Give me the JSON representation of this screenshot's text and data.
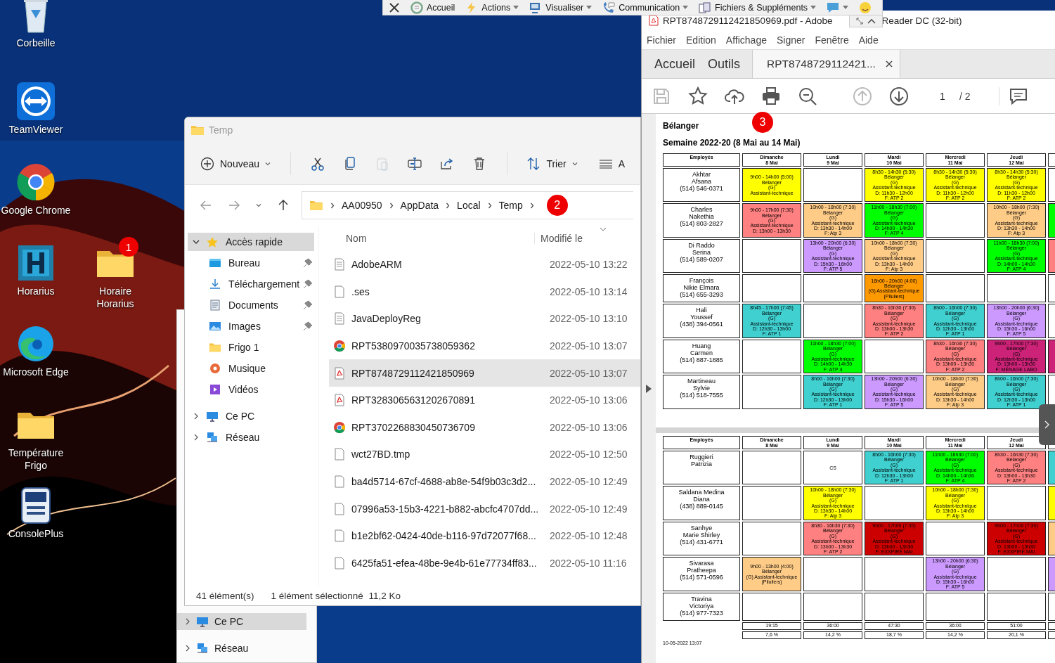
{
  "desktop": {
    "icons": [
      {
        "label": "Corbeille",
        "kind": "recycle"
      },
      {
        "label": "TeamViewer",
        "kind": "teamviewer"
      },
      {
        "label": "Google Chrome",
        "kind": "chrome"
      },
      {
        "label": "Horarius",
        "kind": "horarius"
      },
      {
        "label": "Horaire Horarius",
        "kind": "folder",
        "badge": "1"
      },
      {
        "label": "Microsoft Edge",
        "kind": "edge"
      },
      {
        "label": "Température Frigo",
        "kind": "folder"
      },
      {
        "label": "ConsolePlus",
        "kind": "console"
      }
    ]
  },
  "remote_toolbar": {
    "items": [
      {
        "label": "Accueil",
        "kind": "home",
        "dropdown": false
      },
      {
        "label": "Actions",
        "kind": "bolt",
        "dropdown": true
      },
      {
        "label": "Visualiser",
        "kind": "monitor",
        "dropdown": true
      },
      {
        "label": "Communication",
        "kind": "phone",
        "dropdown": true
      },
      {
        "label": "Fichiers & Suppléments",
        "kind": "files",
        "dropdown": true
      },
      {
        "kind": "chat",
        "dropdown": true
      },
      {
        "kind": "smiley",
        "dropdown": false
      }
    ]
  },
  "explorer": {
    "title": "Temp",
    "toolbar": {
      "new": "Nouveau",
      "sort": "Trier",
      "view": "A",
      "actions": [
        {
          "kind": "cut",
          "disabled": false
        },
        {
          "kind": "copy",
          "disabled": false
        },
        {
          "kind": "paste",
          "disabled": true
        },
        {
          "kind": "rename",
          "disabled": false
        },
        {
          "kind": "share",
          "disabled": false
        },
        {
          "kind": "delete",
          "disabled": false
        }
      ]
    },
    "breadcrumb": [
      "AA00950",
      "AppData",
      "Local",
      "Temp"
    ],
    "badge": "2",
    "nav": [
      {
        "label": "Accès rapide",
        "kind": "star",
        "expanded": true,
        "selected": true,
        "children": [
          {
            "label": "Bureau",
            "kind": "desktop",
            "pinned": true,
            "selected": false
          },
          {
            "label": "Téléchargement",
            "kind": "download",
            "pinned": true,
            "selected": false
          },
          {
            "label": "Documents",
            "kind": "documents",
            "pinned": true,
            "selected": false
          },
          {
            "label": "Images",
            "kind": "images",
            "pinned": true,
            "selected": false
          },
          {
            "label": "Frigo 1",
            "kind": "folder",
            "pinned": false,
            "selected": false
          },
          {
            "label": "Musique",
            "kind": "music",
            "pinned": false,
            "selected": false
          },
          {
            "label": "Vidéos",
            "kind": "videos",
            "pinned": false,
            "selected": false
          }
        ]
      },
      {
        "label": "Ce PC",
        "kind": "pc",
        "expanded": false,
        "selected": false
      },
      {
        "label": "Réseau",
        "kind": "network",
        "expanded": false,
        "selected": false
      }
    ],
    "columns": [
      "Nom",
      "Modifié le"
    ],
    "files": [
      {
        "name": "AdobeARM",
        "modified": "2022-05-10 13:22",
        "kind": "text",
        "selected": false
      },
      {
        "name": ".ses",
        "modified": "2022-05-10 13:14",
        "kind": "blank",
        "selected": false
      },
      {
        "name": "JavaDeployReg",
        "modified": "2022-05-10 13:10",
        "kind": "text",
        "selected": false
      },
      {
        "name": "RPT5380970035738059362",
        "modified": "2022-05-10 13:07",
        "kind": "chrome",
        "selected": false
      },
      {
        "name": "RPT8748729112421850969",
        "modified": "2022-05-10 13:07",
        "kind": "pdf",
        "selected": true
      },
      {
        "name": "RPT3283065631202670891",
        "modified": "2022-05-10 13:06",
        "kind": "pdf",
        "selected": false
      },
      {
        "name": "RPT3702268830450736709",
        "modified": "2022-05-10 13:06",
        "kind": "chrome",
        "selected": false
      },
      {
        "name": "wct27BD.tmp",
        "modified": "2022-05-10 12:50",
        "kind": "blank",
        "selected": false
      },
      {
        "name": "ba4d5714-67cf-4688-ab8e-54f9b03c3d2...",
        "modified": "2022-05-10 12:49",
        "kind": "blank",
        "selected": false
      },
      {
        "name": "07996a53-15b3-4221-b882-abcfc4707dd...",
        "modified": "2022-05-10 12:49",
        "kind": "blank",
        "selected": false
      },
      {
        "name": "b1e2bf62-0424-40de-b116-97d72077f68...",
        "modified": "2022-05-10 12:48",
        "kind": "blank",
        "selected": false
      },
      {
        "name": "6425fa51-efea-48be-9e4b-61e77734ff83...",
        "modified": "2022-05-10 11:16",
        "kind": "blank",
        "selected": false
      }
    ],
    "status": {
      "count": "41 élément(s)",
      "selection": "1 élément sélectionné",
      "size": "11,2 Ko"
    }
  },
  "background_window": {
    "nav": [
      {
        "label": "Ce PC",
        "kind": "pc",
        "selected": true
      },
      {
        "label": "Réseau",
        "kind": "network",
        "selected": false
      }
    ]
  },
  "reader": {
    "title": [
      "RPT8748729112421850969.pdf - Adobe",
      "Reader DC (32-bit)"
    ],
    "menu": [
      "Fichier",
      "Edition",
      "Affichage",
      "Signer",
      "Fenêtre",
      "Aide"
    ],
    "tabs": [
      {
        "label": "Accueil",
        "selected": false,
        "closable": false
      },
      {
        "label": "Outils",
        "selected": false,
        "closable": false
      },
      {
        "label": "RPT87487291124​21...",
        "selected": true,
        "closable": true
      }
    ],
    "toolbar": {
      "actions": [
        {
          "kind": "save",
          "disabled": true
        },
        {
          "kind": "star",
          "disabled": false
        },
        {
          "kind": "upload",
          "disabled": false
        },
        {
          "kind": "print",
          "disabled": false
        },
        {
          "kind": "zoom",
          "disabled": false
        },
        {
          "kind": "up",
          "disabled": true
        },
        {
          "kind": "down",
          "disabled": false
        }
      ],
      "page": "1",
      "pages": "/ 2",
      "badge": "3"
    },
    "document": {
      "heading": "Bélanger",
      "subtitle": "Semaine 2022-20 (8 Mai au 14 Mai)",
      "pages": [
        {
          "employee_header": "Employés",
          "columns": [
            {
              "day": "Dimanche",
              "date": "8 Mai"
            },
            {
              "day": "Lundi",
              "date": "9 Mai"
            },
            {
              "day": "Mardi",
              "date": "10 Mai"
            },
            {
              "day": "Mercredi",
              "date": "11 Mai"
            },
            {
              "day": "Jeudi",
              "date": "12 Mai"
            }
          ],
          "rows": [
            {
              "name": [
                "Akhtar",
                "Afsana",
                "(514) 546-0371"
              ],
              "cells": [
                {
                  "color": "#ffff00",
                  "lines": [
                    "9h00 - 14h00 (5:00)",
                    "Bélanger",
                    "(G)",
                    "Assistant-technique"
                  ]
                },
                {
                  "color": "#ffffff"
                },
                {
                  "color": "#ffff00",
                  "lines": [
                    "8h30 - 14h30 (5:30)",
                    "Bélanger",
                    "(G)",
                    "Assistant-technique",
                    "D: 11h30 - 12h00",
                    "F: ATP 2"
                  ]
                },
                {
                  "color": "#ffff00",
                  "lines": [
                    "8h30 - 14h30 (5:30)",
                    "Bélanger",
                    "(G)",
                    "Assistant-technique",
                    "D: 11h30 - 12h00",
                    "F: ATP 2"
                  ]
                },
                {
                  "color": "#ffff00",
                  "lines": [
                    "8h30 - 14h30 (5:30)",
                    "Bélanger",
                    "(G)",
                    "Assistant-technique",
                    "D: 11h30 - 12h00",
                    "F: ATP 2"
                  ]
                },
                {
                  "color": "#ffffff"
                }
              ]
            },
            {
              "name": [
                "Charles",
                "Nakethia",
                "(514) 803-2827"
              ],
              "cells": [
                {
                  "color": "#ff8080",
                  "lines": [
                    "9h00 - 17h00 (7:30)",
                    "Bélanger",
                    "(G)",
                    "Assistant-technique",
                    "D: 13h00 - 13h30"
                  ]
                },
                {
                  "color": "#ffcc88",
                  "lines": [
                    "10h00 - 18h00 (7:30)",
                    "Bélanger",
                    "(G)",
                    "Assistant-technique",
                    "D: 13h30 - 14h00",
                    "F: Atp 3"
                  ]
                },
                {
                  "color": "#00ff00",
                  "lines": [
                    "11h00 - 18h30 (7:00)",
                    "Bélanger",
                    "(G)",
                    "Assistant-technique",
                    "D: 14h00 - 14h30",
                    "F: ATP 4"
                  ]
                },
                {
                  "color": "#ffffff"
                },
                {
                  "color": "#ffcc88",
                  "lines": [
                    "10h00 - 18h00 (7:30)",
                    "Bélanger",
                    "(G)",
                    "Assistant-technique",
                    "D: 13h30 - 14h00",
                    "F: Atp 3"
                  ]
                },
                {
                  "color": "#00ff00"
                }
              ]
            },
            {
              "name": [
                "Di Raddo",
                "Serina",
                "(514) 589-0207"
              ],
              "cells": [
                {
                  "color": "#ffffff"
                },
                {
                  "color": "#cc99ff",
                  "lines": [
                    "13h00 - 20h00 (6:30)",
                    "Bélanger",
                    "(G)",
                    "Assistant-technique",
                    "D: 15h30 - 16h00",
                    "F: ATP 5"
                  ]
                },
                {
                  "color": "#ffcc88",
                  "lines": [
                    "10h00 - 18h00 (7:30)",
                    "Bélanger",
                    "(G)",
                    "Assistant-technique",
                    "D: 13h30 - 14h00",
                    "F: Atp 3"
                  ]
                },
                {
                  "color": "#ffffff"
                },
                {
                  "color": "#00ff00",
                  "lines": [
                    "11h00 - 18h30 (7:00)",
                    "Bélanger",
                    "(G)",
                    "Assistant-technique",
                    "D: 14h00 - 14h30",
                    "F: ATP 4"
                  ]
                },
                {
                  "color": "#ff8080"
                }
              ]
            },
            {
              "name": [
                "François",
                "Nikie Elmara",
                "(514) 655-3293"
              ],
              "cells": [
                {
                  "color": "#ffffff"
                },
                {
                  "color": "#ffffff"
                },
                {
                  "color": "#ff9900",
                  "lines": [
                    "16h00 - 20h00 (4:00)",
                    "Bélanger",
                    "(G) Assistant-technique",
                    "(Piluliers)"
                  ]
                },
                {
                  "color": "#ffffff"
                },
                {
                  "color": "#ffffff"
                },
                {
                  "color": "#ffffff"
                }
              ]
            },
            {
              "name": [
                "Hali",
                "Youssef",
                "(438) 394-0561"
              ],
              "cells": [
                {
                  "color": "#40d0d0",
                  "lines": [
                    "8h45 - 17h00 (7:45)",
                    "Bélanger",
                    "(G)",
                    "Assistant-technique",
                    "D: 12h30 - 13h00",
                    "F: ATP 1"
                  ]
                },
                {
                  "color": "#ffffff"
                },
                {
                  "color": "#ff8080",
                  "lines": [
                    "8h30 - 16h30 (7:30)",
                    "Bélanger",
                    "(G)",
                    "Assistant-technique",
                    "D: 13h00 - 13h30",
                    "F: ATP 2"
                  ]
                },
                {
                  "color": "#40d0d0",
                  "lines": [
                    "8h00 - 16h00 (7:30)",
                    "Bélanger",
                    "(G)",
                    "Assistant-technique",
                    "D: 12h30 - 13h00",
                    "F: ATP 1"
                  ]
                },
                {
                  "color": "#cc99ff",
                  "lines": [
                    "13h00 - 20h00 (6:30)",
                    "Bélanger",
                    "(G)",
                    "Assistant-technique",
                    "D: 15h30 - 16h00",
                    "F: ATP 5"
                  ]
                },
                {
                  "color": "#ffffff"
                }
              ]
            },
            {
              "name": [
                "Huang",
                "Carmen",
                "(514) 887-1885"
              ],
              "cells": [
                {
                  "color": "#ffffff"
                },
                {
                  "color": "#00ff00",
                  "lines": [
                    "11h00 - 18h30 (7:00)",
                    "Bélanger",
                    "(G)",
                    "Assistant-technique",
                    "D: 14h00 - 14h30",
                    "F: ATP 4"
                  ]
                },
                {
                  "color": "#ffffff"
                },
                {
                  "color": "#ff8080",
                  "lines": [
                    "8h30 - 16h30 (7:30)",
                    "Bélanger",
                    "(G)",
                    "Assistant-technique",
                    "D: 13h00 - 13h30",
                    "F: ATP 2"
                  ]
                },
                {
                  "color": "#cc2277",
                  "lines": [
                    "9h00 - 17h00 (7:30)",
                    "Bélanger",
                    "(G)",
                    "Assistant-technique",
                    "D: 13h00 - 13h30",
                    "F: MÉNAGE LABO"
                  ]
                },
                {
                  "color": "#cc2277"
                }
              ]
            },
            {
              "name": [
                "Martineau",
                "Sylvie",
                "(514) 518-7555"
              ],
              "cells": [
                {
                  "color": "#ffffff"
                },
                {
                  "color": "#40d0d0",
                  "lines": [
                    "8h00 - 16h00 (7:30)",
                    "Bélanger",
                    "(G)",
                    "Assistant-technique",
                    "D: 12h30 - 13h00",
                    "F: ATP 1"
                  ]
                },
                {
                  "color": "#cc99ff",
                  "lines": [
                    "13h00 - 20h00 (6:30)",
                    "Bélanger",
                    "(G)",
                    "Assistant-technique",
                    "D: 15h30 - 16h00",
                    "F: ATP 5"
                  ]
                },
                {
                  "color": "#ffcc88",
                  "lines": [
                    "10h00 - 18h00 (7:30)",
                    "Bélanger",
                    "(G)",
                    "Assistant-technique",
                    "D: 13h30 - 14h00",
                    "F: Atp 3"
                  ]
                },
                {
                  "color": "#40d0d0",
                  "lines": [
                    "8h00 - 16h00 (7:30)",
                    "Bélanger",
                    "(G)",
                    "Assistant-technique",
                    "D: 12h30 - 13h00",
                    "F: ATP 1"
                  ]
                },
                {
                  "color": "#ffffff"
                }
              ]
            }
          ]
        },
        {
          "employee_header": "Employés",
          "columns": [
            {
              "day": "Dimanche",
              "date": "8 Mai"
            },
            {
              "day": "Lundi",
              "date": "9 Mai"
            },
            {
              "day": "Mardi",
              "date": "10 Mai"
            },
            {
              "day": "Mercredi",
              "date": "11 Mai"
            },
            {
              "day": "Jeudi",
              "date": "12 Mai"
            }
          ],
          "rows": [
            {
              "name": [
                "Ruggieri",
                "Patrizia"
              ],
              "cells": [
                {
                  "color": "#ffffff"
                },
                {
                  "color": "#ffffff",
                  "lines": [
                    "CS"
                  ]
                },
                {
                  "color": "#40d0d0",
                  "lines": [
                    "8h00 - 16h00 (7:30)",
                    "Bélanger",
                    "(G)",
                    "Assistant-technique",
                    "D: 12h30 - 13h00",
                    "F: ATP 1"
                  ]
                },
                {
                  "color": "#00ff00",
                  "lines": [
                    "11h00 - 18h30 (7:00)",
                    "Bélanger",
                    "(G)",
                    "Assistant-technique",
                    "D: 14h00 - 14h30",
                    "F: ATP 4"
                  ]
                },
                {
                  "color": "#ff8080",
                  "lines": [
                    "8h30 - 16h30 (7:30)",
                    "Bélanger",
                    "(G)",
                    "Assistant-technique",
                    "D: 13h00 - 13h30",
                    "F: ATP 2"
                  ]
                },
                {
                  "color": "#40d0d0"
                }
              ]
            },
            {
              "name": [
                "Saldana Medina",
                "Diana",
                "(438) 889-0145"
              ],
              "cells": [
                {
                  "color": "#ffffff"
                },
                {
                  "color": "#ffff00",
                  "lines": [
                    "10h00 - 18h00 (7:30)",
                    "Bélanger",
                    "(G)",
                    "Assistant-technique",
                    "D: 13h30 - 14h00",
                    "F: Atp 3"
                  ]
                },
                {
                  "color": "#ffffff"
                },
                {
                  "color": "#ffff00",
                  "lines": [
                    "10h00 - 18h00 (7:30)",
                    "Bélanger",
                    "(G)",
                    "Assistant-technique",
                    "D: 13h30 - 14h00",
                    "F: Atp 3"
                  ]
                },
                {
                  "color": "#ffffff"
                },
                {
                  "color": "#ffff00"
                }
              ]
            },
            {
              "name": [
                "Sanhye",
                "Marie Shirley",
                "(514) 431-6771"
              ],
              "cells": [
                {
                  "color": "#ffffff"
                },
                {
                  "color": "#ff8080",
                  "lines": [
                    "8h30 - 16h30 (7:30)",
                    "Bélanger",
                    "(G)",
                    "Assistant-technique",
                    "D: 13h00 - 13h30",
                    "F: ATP 2"
                  ]
                },
                {
                  "color": "#cc0000",
                  "lines": [
                    "9h00 - 17h00 (7:30)",
                    "Bélanger",
                    "(G)",
                    "Assistant-technique",
                    "D: 13h00 - 13h30",
                    "F: EXXPIRÉ MAI"
                  ]
                },
                {
                  "color": "#ffffff"
                },
                {
                  "color": "#cc0000",
                  "lines": [
                    "9h00 - 17h00 (7:30)",
                    "Bélanger",
                    "(G)",
                    "Assistant-technique",
                    "D: 13h00 - 13h30",
                    "F: EXXPIRÉ MAI"
                  ]
                },
                {
                  "color": "#ffcc88"
                }
              ]
            },
            {
              "name": [
                "Sivarasa",
                "Pratheepa",
                "(514) 571-0596"
              ],
              "cells": [
                {
                  "color": "#ffcc88",
                  "lines": [
                    "9h00 - 13h00 (4:00)",
                    "Bélanger",
                    "(G) Assistant-technique",
                    "(Piluliers)"
                  ]
                },
                {
                  "color": "#ffffff"
                },
                {
                  "color": "#ffffff"
                },
                {
                  "color": "#cc99ff",
                  "lines": [
                    "13h00 - 20h00 (6:30)",
                    "Bélanger",
                    "(G)",
                    "Assistant-technique",
                    "D: 15h30 - 16h00",
                    "F: ATP 5"
                  ]
                },
                {
                  "color": "#ffffff"
                },
                {
                  "color": "#cc99ff"
                }
              ]
            },
            {
              "name": [
                "Travina",
                "Victoriya",
                "(514) 977-7323"
              ],
              "cells": [
                {
                  "color": "#ffffff"
                },
                {
                  "color": "#ffffff"
                },
                {
                  "color": "#ffffff"
                },
                {
                  "color": "#ffffff"
                },
                {
                  "color": "#ffffff"
                },
                {
                  "color": "#ffffff"
                }
              ]
            }
          ],
          "totals": {
            "hours": [
              "19:15",
              "36:00",
              "47:30",
              "36:00",
              "51:00"
            ],
            "percent": [
              "7,6 %",
              "14,2 %",
              "18,7 %",
              "14,2 %",
              "20,1 %"
            ]
          }
        }
      ],
      "footer": "10-05-2022 13:07"
    }
  }
}
